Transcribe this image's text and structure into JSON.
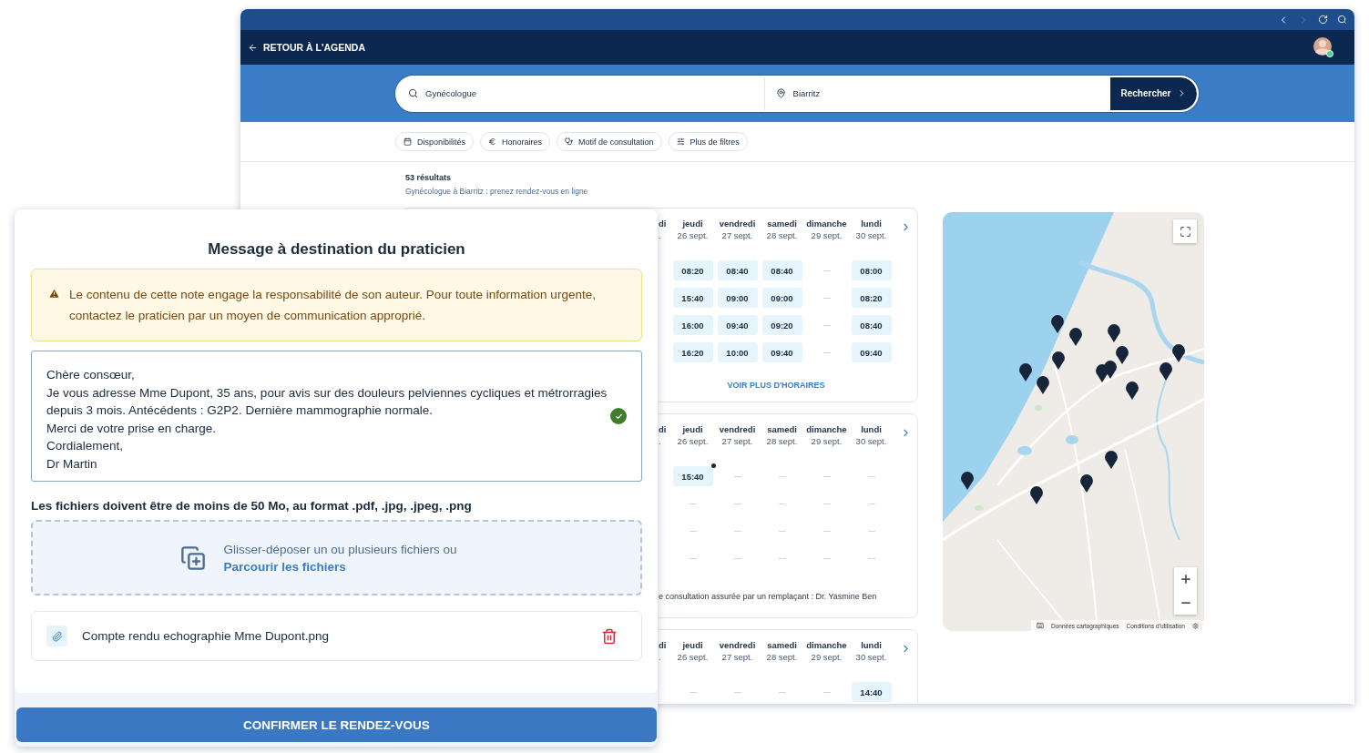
{
  "header": {
    "back_label": "RETOUR À L'AGENDA",
    "user_online": true
  },
  "search": {
    "specialty": "Gynécologue",
    "location": "Biarritz",
    "button": "Rechercher"
  },
  "filters": [
    {
      "label": "Disponibilités"
    },
    {
      "label": "Honoraires"
    },
    {
      "label": "Motif de consultation"
    },
    {
      "label": "Plus de filtres"
    }
  ],
  "results": {
    "count": "53 résultats",
    "subtitle": "Gynécologue à Biarritz : prenez rendez-vous en ligne"
  },
  "cards": [
    {
      "partial_day": "di",
      "partial_date": ".",
      "days": [
        {
          "day": "jeudi",
          "date": "26 sept.",
          "slots": [
            {
              "kind": "time",
              "time": "08:20",
              "dot": false
            },
            {
              "kind": "time",
              "time": "15:40",
              "dot": false
            },
            {
              "kind": "time",
              "time": "16:00",
              "dot": false
            },
            {
              "kind": "time",
              "time": "16:20",
              "dot": false
            }
          ]
        },
        {
          "day": "vendredi",
          "date": "27 sept.",
          "slots": [
            {
              "kind": "time",
              "time": "08:40",
              "dot": false
            },
            {
              "kind": "time",
              "time": "09:00",
              "dot": false
            },
            {
              "kind": "time",
              "time": "09:40",
              "dot": false
            },
            {
              "kind": "time",
              "time": "10:00",
              "dot": false
            }
          ]
        },
        {
          "day": "samedi",
          "date": "28 sept.",
          "slots": [
            {
              "kind": "time",
              "time": "08:40",
              "dot": false
            },
            {
              "kind": "time",
              "time": "09:00",
              "dot": false
            },
            {
              "kind": "time",
              "time": "09:20",
              "dot": false
            },
            {
              "kind": "time",
              "time": "09:40",
              "dot": false
            }
          ]
        },
        {
          "day": "dimanche",
          "date": "29 sept.",
          "slots": [
            {
              "kind": "empty"
            },
            {
              "kind": "empty"
            },
            {
              "kind": "empty"
            },
            {
              "kind": "empty"
            }
          ]
        },
        {
          "day": "lundi",
          "date": "30 sept.",
          "slots": [
            {
              "kind": "time",
              "time": "08:00",
              "dot": false
            },
            {
              "kind": "time",
              "time": "08:20",
              "dot": false
            },
            {
              "kind": "time",
              "time": "08:40",
              "dot": false
            },
            {
              "kind": "time",
              "time": "09:40",
              "dot": false
            }
          ]
        }
      ],
      "more": "VOIR PLUS D'HORAIRES"
    },
    {
      "partial_day": "di",
      "partial_date": ".",
      "days": [
        {
          "day": "jeudi",
          "date": "26 sept.",
          "slots": [
            {
              "kind": "time",
              "time": "15:40",
              "dot": true
            },
            {
              "kind": "empty"
            },
            {
              "kind": "empty"
            },
            {
              "kind": "empty"
            }
          ]
        },
        {
          "day": "vendredi",
          "date": "27 sept.",
          "slots": [
            {
              "kind": "empty"
            },
            {
              "kind": "empty"
            },
            {
              "kind": "empty"
            },
            {
              "kind": "empty"
            }
          ]
        },
        {
          "day": "samedi",
          "date": "28 sept.",
          "slots": [
            {
              "kind": "empty"
            },
            {
              "kind": "empty"
            },
            {
              "kind": "empty"
            },
            {
              "kind": "empty"
            }
          ]
        },
        {
          "day": "dimanche",
          "date": "29 sept.",
          "slots": [
            {
              "kind": "empty"
            },
            {
              "kind": "empty"
            },
            {
              "kind": "empty"
            },
            {
              "kind": "empty"
            }
          ]
        },
        {
          "day": "lundi",
          "date": "30 sept.",
          "slots": [
            {
              "kind": "empty"
            },
            {
              "kind": "empty"
            },
            {
              "kind": "empty"
            },
            {
              "kind": "empty"
            }
          ]
        }
      ],
      "note": "e consultation assurée par un remplaçant : Dr. Yasmine Ben"
    },
    {
      "partial_day": "di",
      "partial_date": ".",
      "days": [
        {
          "day": "jeudi",
          "date": "26 sept.",
          "slots": [
            {
              "kind": "empty"
            }
          ]
        },
        {
          "day": "vendredi",
          "date": "27 sept.",
          "slots": [
            {
              "kind": "empty"
            }
          ]
        },
        {
          "day": "samedi",
          "date": "28 sept.",
          "slots": [
            {
              "kind": "empty"
            }
          ]
        },
        {
          "day": "dimanche",
          "date": "29 sept.",
          "slots": [
            {
              "kind": "empty"
            }
          ]
        },
        {
          "day": "lundi",
          "date": "30 sept.",
          "slots": [
            {
              "kind": "time",
              "time": "14:40",
              "dot": false
            }
          ]
        }
      ]
    }
  ],
  "map": {
    "kind": "picture",
    "attribution": [
      "Données cartographiques",
      "Conditions d'utilisation"
    ]
  },
  "modal": {
    "title": "Message à destination du praticien",
    "warning": "Le contenu de cette note engage la responsabilité de son auteur. Pour toute information urgente, contactez le praticien par un moyen de communication approprié.",
    "message": "Chère consœur,\nJe vous adresse Mme Dupont, 35 ans, pour avis sur des douleurs pelviennes cycliques et métrorragies depuis 3 mois. Antécédents : G2P2. Dernière mammographie normale.\nMerci de votre prise en charge.\nCordialement,\nDr Martin",
    "message_valid": true,
    "files_hint": "Les fichiers doivent être de moins de 50 Mo, au format .pdf, .jpg, .jpeg, .png",
    "dropzone": {
      "text": "Glisser-déposer un ou plusieurs fichiers ou",
      "link": "Parcourir les fichiers"
    },
    "files": [
      {
        "name": "Compte rendu echographie Mme Dupont.png"
      }
    ],
    "confirm": "CONFIRMER LE RENDEZ-VOUS"
  }
}
